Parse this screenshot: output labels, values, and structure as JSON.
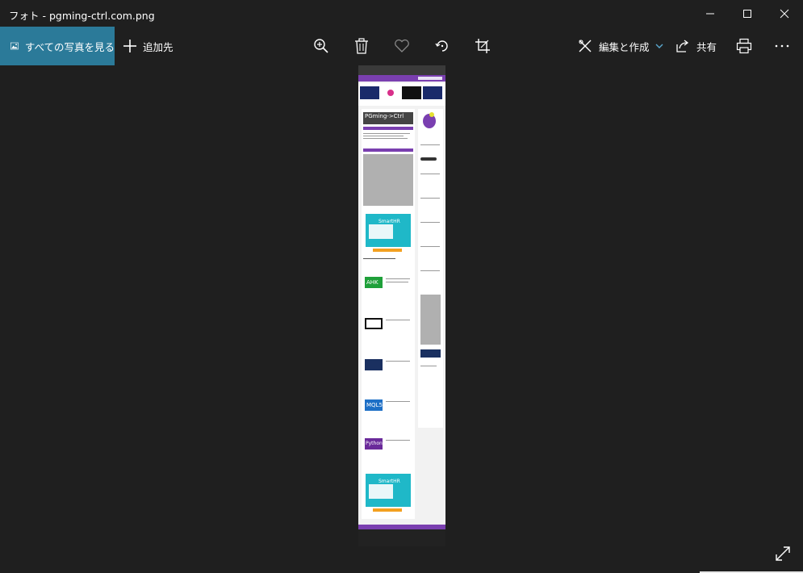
{
  "window": {
    "title": "フォト - pgming-ctrl.com.png",
    "controls": {
      "minimize": "minimize-icon",
      "maximize": "maximize-icon",
      "close": "close-icon"
    }
  },
  "toolbar": {
    "all_photos_label": "すべての写真を見る",
    "add_to_label": "追加先",
    "edit_create_label": "編集と作成",
    "share_label": "共有",
    "icons": [
      "zoom-in-icon",
      "delete-icon",
      "favorite-icon",
      "rotate-icon",
      "crop-icon",
      "print-icon",
      "more-icon"
    ]
  },
  "preview": {
    "logo_text": "PGming->Ctrl",
    "ad_text": "SmartHR",
    "thumbs": [
      "AHK",
      "MQL5",
      "Python"
    ]
  },
  "colors": {
    "accent": "#2b7a99",
    "background": "#1f1f1f",
    "site_purple": "#7a3fb0",
    "ad_teal": "#1fb8c8"
  }
}
